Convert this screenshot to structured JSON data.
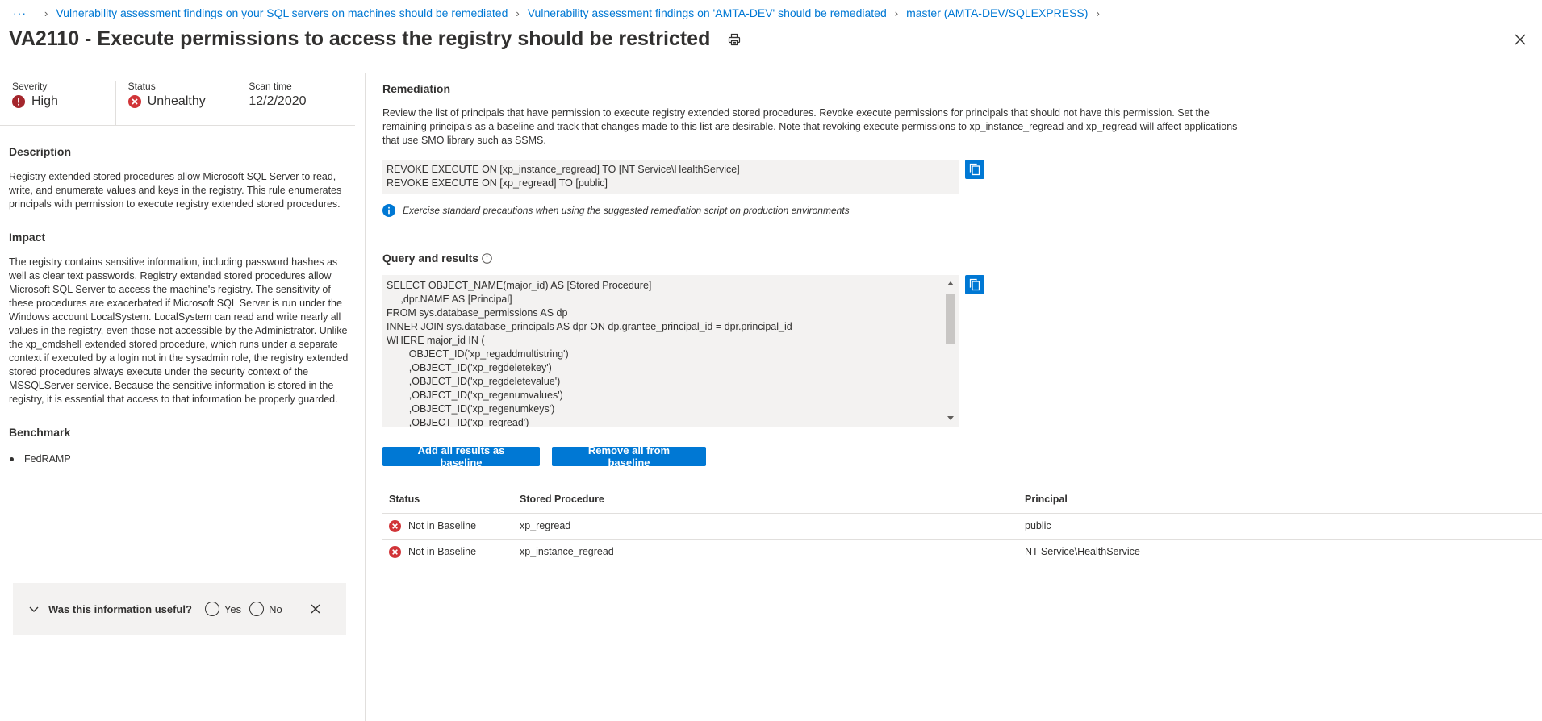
{
  "breadcrumb": {
    "more": "···",
    "items": [
      "Vulnerability assessment findings on your SQL servers on machines should be remediated",
      "Vulnerability assessment findings on 'AMTA-DEV' should be remediated",
      "master (AMTA-DEV/SQLEXPRESS)"
    ]
  },
  "title": "VA2110 - Execute permissions to access the registry should be restricted",
  "summary": {
    "severity_label": "Severity",
    "severity_value": "High",
    "status_label": "Status",
    "status_value": "Unhealthy",
    "scan_label": "Scan time",
    "scan_value": "12/2/2020"
  },
  "description": {
    "heading": "Description",
    "text": "Registry extended stored procedures allow Microsoft SQL Server to read, write, and enumerate values and keys in the registry. This rule enumerates principals with permission to execute registry extended stored procedures."
  },
  "impact": {
    "heading": "Impact",
    "text": "The registry contains sensitive information, including password hashes as well as clear text passwords. Registry extended stored procedures allow Microsoft SQL Server to access the machine's registry. The sensitivity of these procedures are exacerbated if Microsoft SQL Server is run under the Windows account LocalSystem. LocalSystem can read and write nearly all values in the registry, even those not accessible by the Administrator. Unlike the xp_cmdshell extended stored procedure, which runs under a separate context if executed by a login not in the sysadmin role, the registry extended stored procedures always execute under the security context of the MSSQLServer service. Because the sensitive information is stored in the registry, it is essential that access to that information be properly guarded."
  },
  "benchmark": {
    "heading": "Benchmark",
    "items": [
      "FedRAMP"
    ]
  },
  "feedback": {
    "question": "Was this information useful?",
    "yes": "Yes",
    "no": "No"
  },
  "remediation": {
    "heading": "Remediation",
    "text": "Review the list of principals that have permission to execute registry extended stored procedures. Revoke execute permissions for principals that should not have this permission. Set the remaining principals as a baseline and track that changes made to this list are desirable. Note that revoking execute permissions to xp_instance_regread and xp_regread will affect applications that use SMO library such as SSMS.",
    "script_line1": "REVOKE EXECUTE ON [xp_instance_regread] TO [NT Service\\HealthService]",
    "script_line2": "REVOKE EXECUTE ON [xp_regread] TO [public]",
    "caution": "Exercise standard precautions when using the suggested remediation script on production environments"
  },
  "query": {
    "heading": "Query and results",
    "code": "SELECT OBJECT_NAME(major_id) AS [Stored Procedure]\n     ,dpr.NAME AS [Principal]\nFROM sys.database_permissions AS dp\nINNER JOIN sys.database_principals AS dpr ON dp.grantee_principal_id = dpr.principal_id\nWHERE major_id IN (\n        OBJECT_ID('xp_regaddmultistring')\n        ,OBJECT_ID('xp_regdeletekey')\n        ,OBJECT_ID('xp_regdeletevalue')\n        ,OBJECT_ID('xp_regenumvalues')\n        ,OBJECT_ID('xp_regenumkeys')\n        ,OBJECT_ID('xp_regread')"
  },
  "buttons": {
    "add_baseline": "Add all results as baseline",
    "remove_baseline": "Remove all from baseline"
  },
  "results": {
    "columns": [
      "Status",
      "Stored Procedure",
      "Principal"
    ],
    "rows": [
      {
        "status": "Not in Baseline",
        "procedure": "xp_regread",
        "principal": "public"
      },
      {
        "status": "Not in Baseline",
        "procedure": "xp_instance_regread",
        "principal": "NT Service\\HealthService"
      }
    ]
  },
  "colors": {
    "accent": "#0078d4",
    "error": "#d13438",
    "text": "#323130"
  }
}
